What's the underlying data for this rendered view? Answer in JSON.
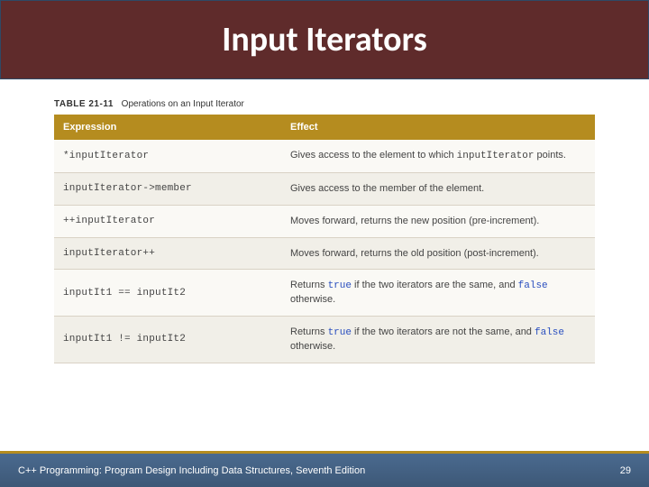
{
  "slide": {
    "title": "Input Iterators"
  },
  "table": {
    "label": "TABLE 21-11",
    "caption": "Operations on an Input Iterator",
    "headers": {
      "expression": "Expression",
      "effect": "Effect"
    },
    "rows": [
      {
        "expr": "*inputIterator",
        "effect_pre": "Gives access to the element to which ",
        "effect_code": "inputIterator",
        "effect_post": " points."
      },
      {
        "expr": "inputIterator->member",
        "effect_pre": "Gives access to the member of the element.",
        "effect_code": "",
        "effect_post": ""
      },
      {
        "expr": "++inputIterator",
        "effect_pre": "Moves forward, returns the new position (pre-increment).",
        "effect_code": "",
        "effect_post": ""
      },
      {
        "expr": "inputIterator++",
        "effect_pre": "Moves forward, returns the old position (post-increment).",
        "effect_code": "",
        "effect_post": ""
      },
      {
        "expr": "inputIt1 == inputIt2",
        "effect_pre": "Returns ",
        "kw1": "true",
        "mid": " if the two iterators are the same, and ",
        "kw2": "false",
        "effect_post": " otherwise."
      },
      {
        "expr": "inputIt1 != inputIt2",
        "effect_pre": "Returns ",
        "kw1": "true",
        "mid": " if the two iterators are not the same, and ",
        "kw2": "false",
        "effect_post": " otherwise."
      }
    ]
  },
  "footer": {
    "text": "C++ Programming: Program Design Including Data Structures, Seventh Edition",
    "page": "29"
  }
}
